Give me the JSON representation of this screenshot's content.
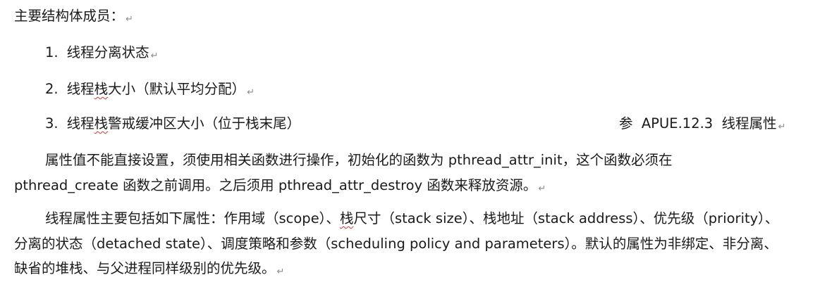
{
  "heading": "主要结构体成员：",
  "list": [
    {
      "num": "1.",
      "pre": "线程分离状态",
      "squig": "",
      "post": ""
    },
    {
      "num": "2.",
      "pre": "线程",
      "squig": "栈",
      "post": "大小（默认平均分配）"
    },
    {
      "num": "3.",
      "pre": "线程",
      "squig": "栈",
      "post": "警戒缓冲区大小（位于栈末尾）"
    }
  ],
  "reference": "参  APUE.12.3  线程属性",
  "para1": {
    "line1": "属性值不能直接设置，须使用相关函数进行操作，初始化的函数为 pthread_attr_init，这个函数必须在",
    "line2": "pthread_create 函数之前调用。之后须用 pthread_attr_destroy 函数来释放资源。"
  },
  "para2": {
    "line1_pre": "线程属性主要包括如下属性：作用域（scope）、",
    "line1_squig": "栈",
    "line1_post": "尺寸（stack size）、栈地址（stack address）、优先级（priority）、",
    "line2": "分离的状态（detached state）、调度策略和参数（scheduling policy and parameters）。默认的属性为非绑定、非分离、",
    "line3": "缺省的堆栈、与父进程同样级别的优先级。"
  },
  "paragraph_mark": "↵"
}
